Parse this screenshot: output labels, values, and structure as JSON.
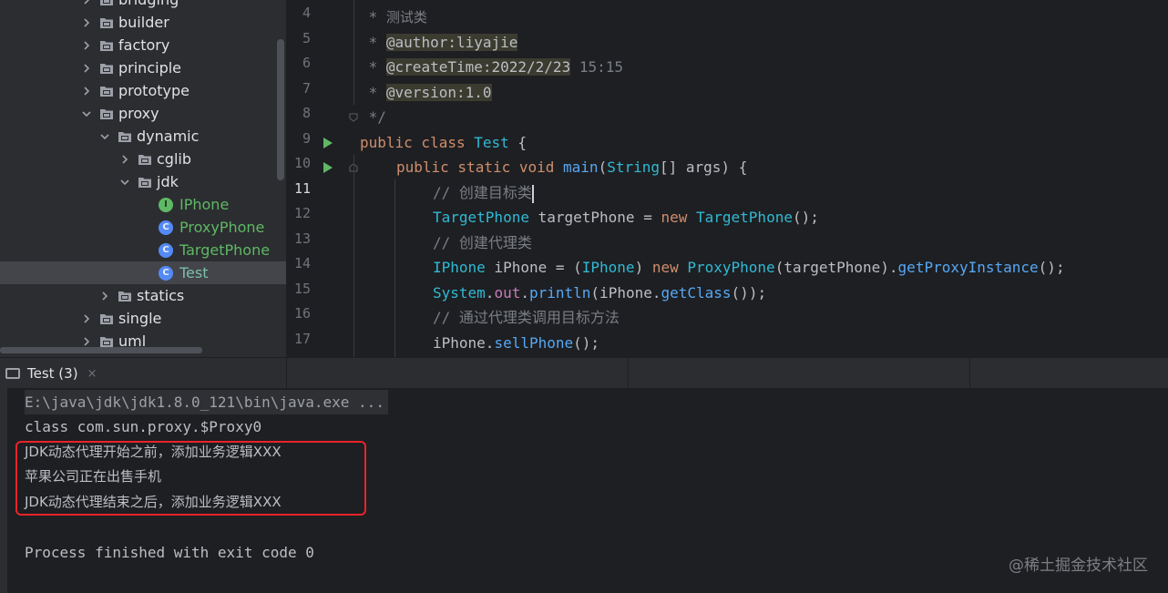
{
  "project_tree": {
    "items": [
      {
        "label": "bridging",
        "kind": "folder",
        "indent": 0,
        "state": "collapsed"
      },
      {
        "label": "builder",
        "kind": "folder",
        "indent": 0,
        "state": "collapsed"
      },
      {
        "label": "factory",
        "kind": "folder",
        "indent": 0,
        "state": "collapsed"
      },
      {
        "label": "principle",
        "kind": "folder",
        "indent": 0,
        "state": "collapsed"
      },
      {
        "label": "prototype",
        "kind": "folder",
        "indent": 0,
        "state": "collapsed"
      },
      {
        "label": "proxy",
        "kind": "folder",
        "indent": 0,
        "state": "expanded"
      },
      {
        "label": "dynamic",
        "kind": "folder",
        "indent": 1,
        "state": "expanded"
      },
      {
        "label": "cglib",
        "kind": "folder",
        "indent": 2,
        "state": "collapsed"
      },
      {
        "label": "jdk",
        "kind": "folder",
        "indent": 2,
        "state": "expanded"
      },
      {
        "label": "IPhone",
        "kind": "interface",
        "indent": 3
      },
      {
        "label": "ProxyPhone",
        "kind": "class",
        "indent": 3
      },
      {
        "label": "TargetPhone",
        "kind": "class",
        "indent": 3
      },
      {
        "label": "Test",
        "kind": "class",
        "indent": 3,
        "selected": true
      },
      {
        "label": "statics",
        "kind": "folder",
        "indent": 1,
        "state": "collapsed"
      },
      {
        "label": "single",
        "kind": "folder",
        "indent": 0,
        "state": "collapsed"
      },
      {
        "label": "uml",
        "kind": "folder",
        "indent": 0,
        "state": "collapsed"
      }
    ]
  },
  "editor": {
    "line_numbers": [
      "4",
      "5",
      "6",
      "7",
      "8",
      "9",
      "10",
      "11",
      "12",
      "13",
      "14",
      "15",
      "16",
      "17"
    ],
    "current_line": "11",
    "doc": {
      "l4_prefix": " * ",
      "l4_text": "测试类",
      "l5_prefix": " * ",
      "l5_tag": "@author:liyajie",
      "l6_prefix": " * ",
      "l6_tag": "@createTime:2022/2/23",
      "l6_rest": " 15:15",
      "l7_prefix": " * ",
      "l7_tag": "@version:1.0",
      "l8": " */"
    },
    "code": {
      "l9_kw": "public class ",
      "l9_name": "Test",
      "l9_rest": " {",
      "l10_kw": "public static void ",
      "l10_fn": "main",
      "l10_p1": "(",
      "l10_type": "String",
      "l10_p2": "[] args) {",
      "l11": "// 创建目标类",
      "l12_type": "TargetPhone",
      "l12_a": " targetPhone = ",
      "l12_new": "new ",
      "l12_type2": "TargetPhone",
      "l12_b": "();",
      "l13": "// 创建代理类",
      "l14_type": "IPhone",
      "l14_a": " iPhone = (",
      "l14_type2": "IPhone",
      "l14_b": ") ",
      "l14_new": "new ",
      "l14_cls": "ProxyPhone",
      "l14_c": "(targetPhone).",
      "l14_fn": "getProxyInstance",
      "l14_d": "();",
      "l15_sys": "System",
      "l15_dot": ".",
      "l15_out": "out",
      "l15_dot2": ".",
      "l15_fn": "println",
      "l15_a": "(iPhone.",
      "l15_fn2": "getClass",
      "l15_b": "());",
      "l16": "// 通过代理类调用目标方法",
      "l17_a": "iPhone.",
      "l17_fn": "sellPhone",
      "l17_b": "();"
    }
  },
  "run_panel": {
    "tab_label": "Test (3)",
    "close_glyph": "×",
    "console": [
      "E:\\java\\jdk\\jdk1.8.0_121\\bin\\java.exe ...",
      "class com.sun.proxy.$Proxy0",
      "JDK动态代理开始之前，添加业务逻辑XXX",
      "苹果公司正在出售手机",
      "JDK动态代理结束之后，添加业务逻辑XXX",
      "",
      "Process finished with exit code 0"
    ]
  },
  "watermark": "@稀土掘金技术社区",
  "colors": {
    "highlight_box": "#e8242a",
    "keyword": "#cf8e6d",
    "function": "#56a8f5",
    "comment": "#7a7e85"
  }
}
